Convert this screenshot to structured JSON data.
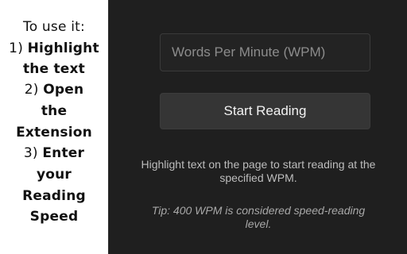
{
  "instructions": {
    "lines": [
      {
        "plain": "To use it:",
        "bold": ""
      },
      {
        "plain": "1) ",
        "bold": "Highlight"
      },
      {
        "plain": "",
        "bold": "the text"
      },
      {
        "plain": "2) ",
        "bold": "Open"
      },
      {
        "plain": "",
        "bold": "the"
      },
      {
        "plain": "",
        "bold": "Extension"
      },
      {
        "plain": "3) ",
        "bold": "Enter"
      },
      {
        "plain": "",
        "bold": "your"
      },
      {
        "plain": "",
        "bold": "Reading"
      },
      {
        "plain": "",
        "bold": "Speed"
      }
    ]
  },
  "popup": {
    "wpm_placeholder": "Words Per Minute (WPM)",
    "wpm_value": "",
    "start_label": "Start Reading",
    "hint_text": "Highlight text on the page to start reading at the specified WPM.",
    "tip_text": "Tip: 400 WPM is considered speed-reading level."
  },
  "colors": {
    "popup_background": "#1f1f1f",
    "input_background": "#232323",
    "button_background": "#353535"
  }
}
